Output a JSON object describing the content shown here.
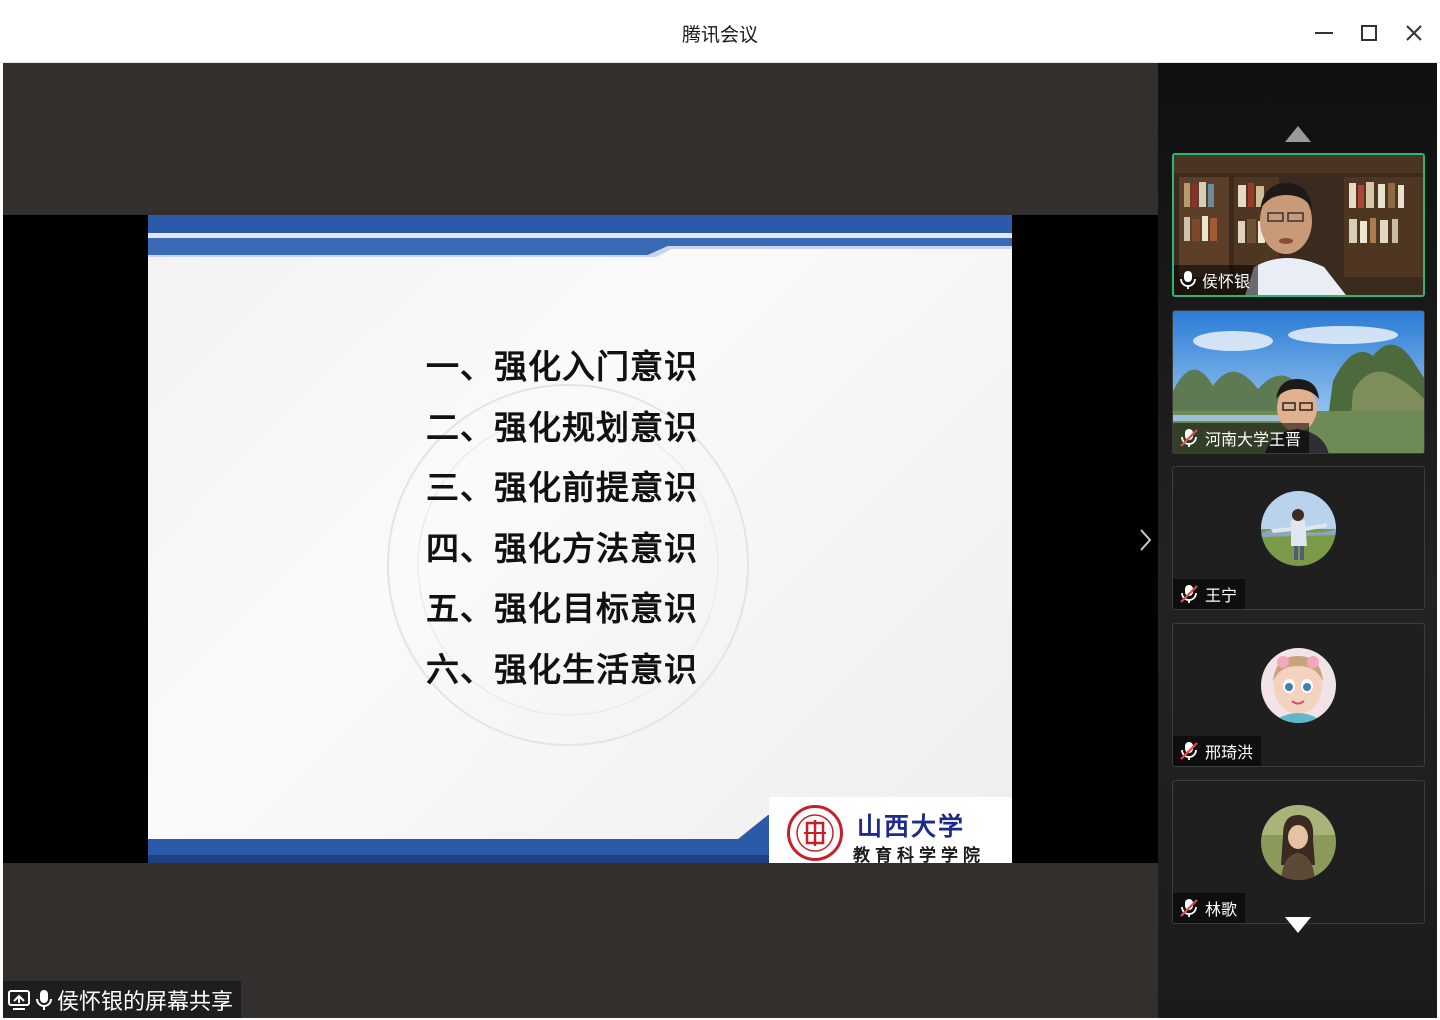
{
  "window": {
    "title": "腾讯会议"
  },
  "slide": {
    "items": [
      "一、强化入门意识",
      "二、强化规划意识",
      "三、强化前提意识",
      "四、强化方法意识",
      "五、强化目标意识",
      "六、强化生活意识"
    ],
    "logo_name": "山西大学",
    "logo_dept": "教育科学学院"
  },
  "share_label": "侯怀银的屏幕共享",
  "participants": [
    {
      "name": "侯怀银",
      "mic": "on",
      "video": "camera"
    },
    {
      "name": "河南大学王晋",
      "mic": "muted",
      "video": "camera"
    },
    {
      "name": "王宁",
      "mic": "muted",
      "video": "avatar"
    },
    {
      "name": "邢琦洪",
      "mic": "muted",
      "video": "avatar"
    },
    {
      "name": "林歌",
      "mic": "muted",
      "video": "avatar"
    }
  ],
  "colors": {
    "active_speaker_border": "#2bb673",
    "muted_mic": "#e5484d",
    "slide_accent": "#2b5aa8"
  }
}
